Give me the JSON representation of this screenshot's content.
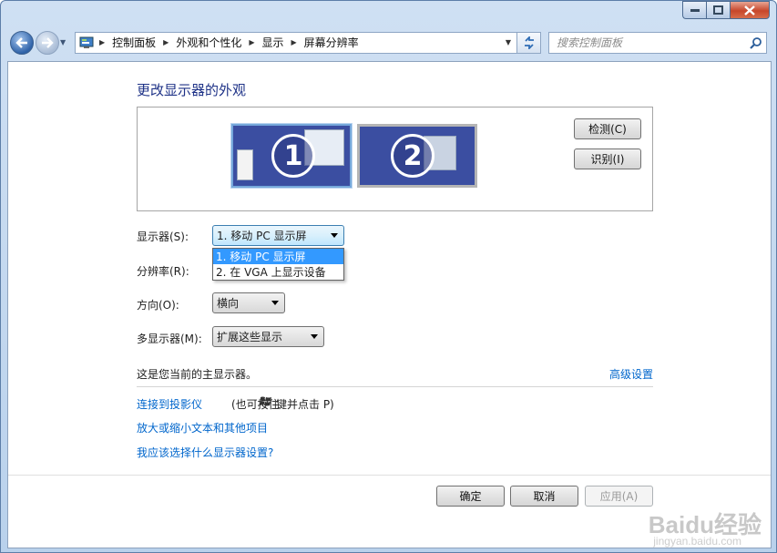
{
  "window": {
    "caption": {
      "minimize": "minimize",
      "maximize": "maximize",
      "close": "close"
    }
  },
  "navbar": {
    "breadcrumbs": [
      "控制面板",
      "外观和个性化",
      "显示",
      "屏幕分辨率"
    ],
    "search_placeholder": "搜索控制面板"
  },
  "main": {
    "title": "更改显示器的外观",
    "monitors": [
      {
        "number": "1",
        "selected": true
      },
      {
        "number": "2",
        "selected": false
      }
    ],
    "detect_button": "检测(C)",
    "identify_button": "识别(I)",
    "display_label": "显示器(S):",
    "display_value": "1. 移动 PC 显示屏",
    "display_options": [
      "1. 移动 PC 显示屏",
      "2. 在 VGA 上显示设备"
    ],
    "resolution_label": "分辨率(R):",
    "orientation_label": "方向(O):",
    "orientation_value": "横向",
    "multi_display_label": "多显示器(M):",
    "multi_display_value": "扩展这些显示",
    "primary_note": "这是您当前的主显示器。",
    "advanced_link": "高级设置",
    "projector_link": "连接到投影仪",
    "projector_hint_pre": "(也可按住",
    "projector_hint_post": "键并点击 P)",
    "text_size_link": "放大或缩小文本和其他项目",
    "which_settings_link": "我应该选择什么显示器设置?"
  },
  "footer": {
    "ok": "确定",
    "cancel": "取消",
    "apply": "应用(A)"
  },
  "watermark": {
    "brand": "Baidu经验",
    "url": "jingyan.baidu.com"
  },
  "colors": {
    "title_blue": "#1e3287",
    "link_blue": "#0066cc",
    "selection_blue": "#3399ff",
    "monitor_blue": "#3b4ea1"
  }
}
